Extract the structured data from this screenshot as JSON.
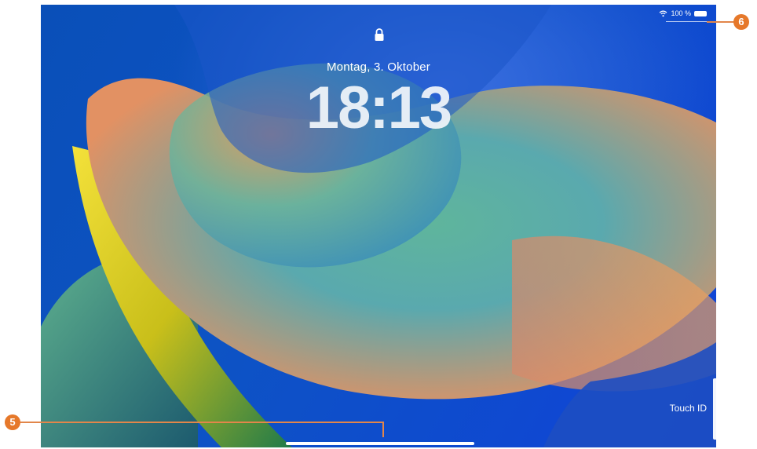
{
  "status_bar": {
    "battery_text": "100 %",
    "icons": [
      "wifi-icon",
      "battery-icon"
    ]
  },
  "lock_screen": {
    "lock_icon": "lock-icon",
    "date": "Montag, 3. Oktober",
    "time": "18:13",
    "touch_id_label": "Touch ID"
  },
  "callouts": {
    "home_indicator": "5",
    "status_bar": "6"
  },
  "colors": {
    "callout": "#e6782a",
    "wallpaper_blue": "#0d53c4",
    "wallpaper_orange": "#e09060",
    "wallpaper_teal": "#4fb0a8",
    "wallpaper_yellow": "#e8cc24"
  }
}
